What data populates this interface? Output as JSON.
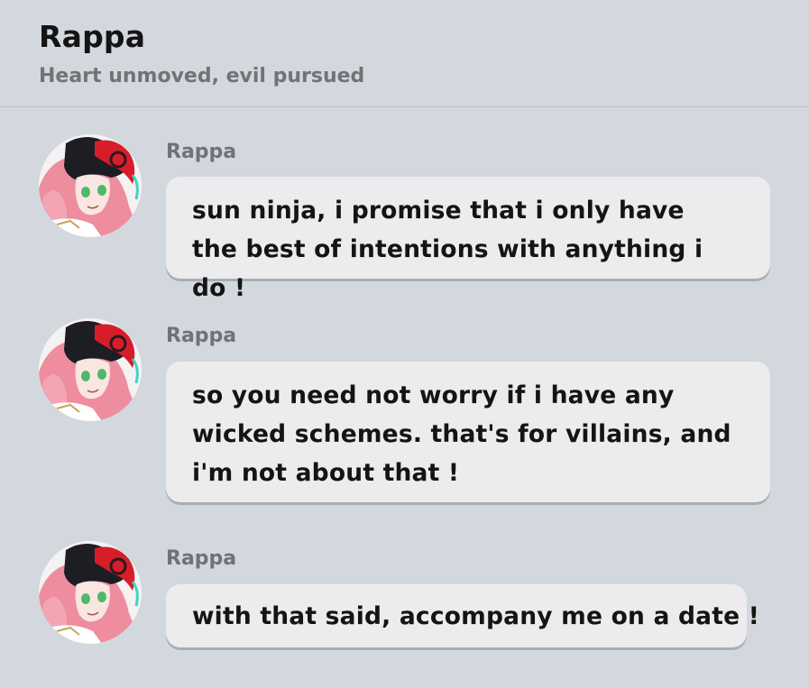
{
  "header": {
    "title": "Rappa",
    "subtitle": "Heart unmoved, evil pursued"
  },
  "messages": [
    {
      "sender": "Rappa",
      "text": "sun ninja, i promise that i only have the best of intentions with anything i do !",
      "avatar_icon": "rappa-avatar"
    },
    {
      "sender": "Rappa",
      "text": "so you need not worry if i have any wicked schemes. that's for villains, and i'm not about that !",
      "avatar_icon": "rappa-avatar"
    },
    {
      "sender": "Rappa",
      "text": "with that said, accompany me on a date !",
      "avatar_icon": "rappa-avatar"
    }
  ],
  "colors": {
    "background": "#d3d8de",
    "bubble": "#ececee",
    "bubble_shadow": "#a9adb4",
    "hair": "#ee8d9e",
    "mask": "#d71d2a",
    "eye": "#4fb86a"
  }
}
